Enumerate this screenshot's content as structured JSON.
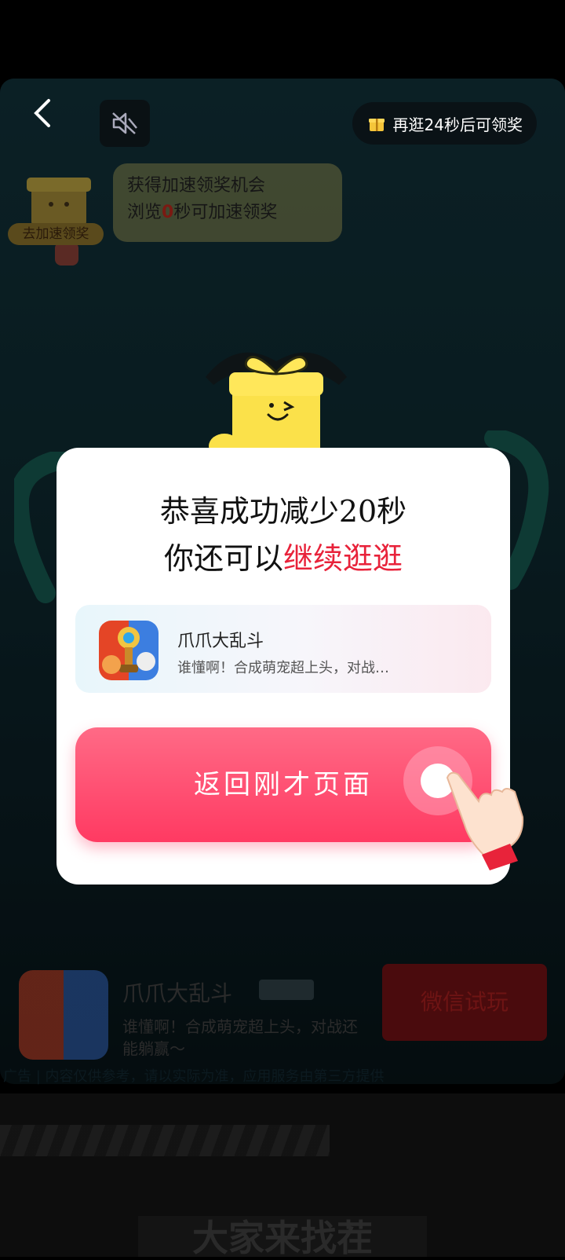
{
  "topbar": {
    "back_icon": "chevron-left-icon",
    "mute_icon": "speaker-muted-icon",
    "reward_timer": "再逛24秒后可领奖",
    "reward_icon": "gift-icon"
  },
  "boost_tip": {
    "line1": "获得加速领奖机会",
    "line2_prefix": "浏览",
    "line2_value": "0",
    "line2_suffix": "秒可加速领奖",
    "badge_label": "去加速领奖"
  },
  "modal": {
    "title_line1": "恭喜成功减少20秒",
    "title_line2_prefix": "你还可以",
    "title_line2_highlight": "继续逛逛",
    "app": {
      "name": "爪爪大乱斗",
      "desc": "谁懂啊！合成萌宠超上头，对战…"
    },
    "return_button": "返回刚才页面"
  },
  "ad": {
    "name": "爪爪大乱斗",
    "desc": "谁懂啊！合成萌宠超上头，对战还能躺赢～",
    "cta": "微信试玩",
    "disclaimer": "广告 | 内容仅供参考，请以实际为准，应用服务由第三方提供"
  },
  "video": {
    "caption": "大家来找茬"
  },
  "colors": {
    "accent": "#ff3a62",
    "highlight_text": "#e8223a"
  }
}
